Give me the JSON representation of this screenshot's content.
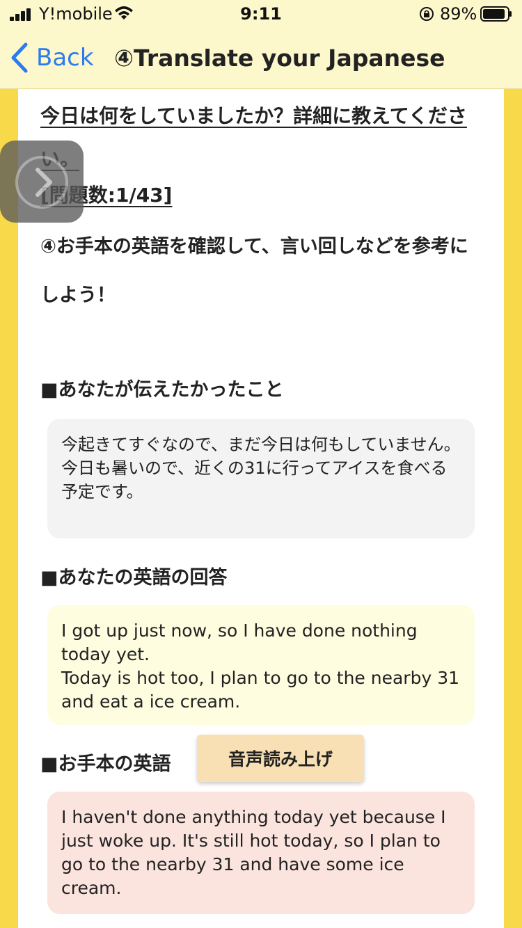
{
  "status_bar": {
    "carrier": "Y!mobile",
    "time": "9:11",
    "battery": "89%"
  },
  "nav": {
    "back_label": "Back",
    "title": "④Translate your Japanese"
  },
  "question": {
    "text": "今日は何をしていましたか？詳細に教えてください。",
    "count": "[問題数:1/43]"
  },
  "instruction": "④お手本の英語を確認して、言い回しなどを参考にしよう！",
  "sections": {
    "intended": {
      "title": "■あなたが伝えたかったこと",
      "text_line1": "今起きてすぐなので、まだ今日は何もしていません。",
      "text_line2": "今日も暑いので、近くの31に行ってアイスを食べる予定です。"
    },
    "your_answer": {
      "title": "■あなたの英語の回答",
      "text_line1": "I got up just now, so I have done nothing today yet.",
      "text_line2": "Today is hot too, I plan to go to the nearby 31 and eat a ice cream."
    },
    "model": {
      "title": "■お手本の英語",
      "speak_button": "音声読み上げ",
      "text": "I haven't done anything today yet because I just woke up. It's still hot today, so I plan to go to the nearby 31 and have some ice cream."
    }
  },
  "colors": {
    "background": "#f8d94a",
    "header": "#fdf7cc",
    "link": "#2b7bf0",
    "intended_box": "#f3f3f3",
    "answer_box": "#fefde0",
    "model_box": "#fbe3de",
    "speak_button": "#f8dfb4"
  }
}
